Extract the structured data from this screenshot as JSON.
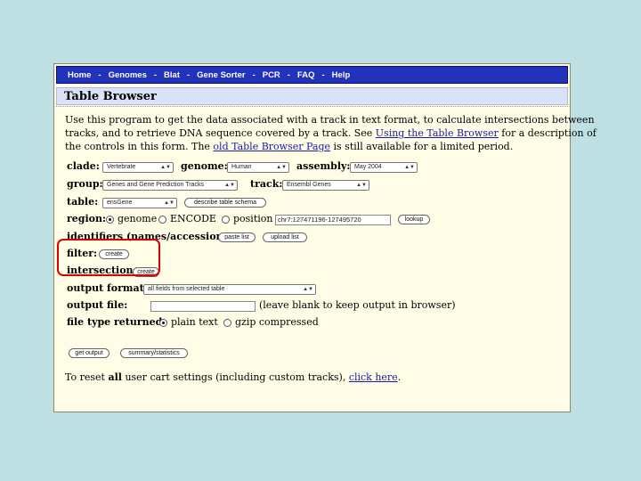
{
  "nav": {
    "items": [
      "Home",
      "Genomes",
      "Blat",
      "Gene Sorter",
      "PCR",
      "FAQ",
      "Help"
    ],
    "separator": "-"
  },
  "title": "Table Browser",
  "intro": {
    "line1": "Use this program to get the data associated with a track in text format, to calculate intersections between",
    "line2_pre": "tracks, and to retrieve DNA sequence covered by a track. See ",
    "line2_link": "Using the Table Browser",
    "line2_post": " for a description of",
    "line3_pre": "the controls in this form. The ",
    "line3_link": "old Table Browser Page",
    "line3_post": " is still available for a limited period."
  },
  "form": {
    "clade_label": "clade:",
    "clade_value": "Vertebrate",
    "genome_label": "genome:",
    "genome_value": "Human",
    "assembly_label": "assembly:",
    "assembly_value": "May 2004",
    "group_label": "group:",
    "group_value": "Genes and Gene Prediction Tracks",
    "track_label": "track:",
    "track_value": "Ensembl Genes",
    "table_label": "table:",
    "table_value": "ensGene",
    "describe_button": "describe table schema",
    "region_label": "region:",
    "region_genome": "genome",
    "region_encode": "ENCODE",
    "region_position": "position",
    "position_value": "chr7:127471196-127495720",
    "lookup_button": "lookup",
    "identifiers_label": "identifiers (names/accessions):",
    "paste_button": "paste list",
    "upload_button": "upload list",
    "filter_label": "filter:",
    "filter_button": "create",
    "intersection_label": "intersection:",
    "intersection_button": "create",
    "output_format_label": "output format:",
    "output_format_value": "all fields from selected table",
    "output_file_label": "output file:",
    "output_file_value": "",
    "output_file_hint": "(leave blank to keep output in browser)",
    "file_type_label": "file type returned:",
    "file_type_plain": "plain text",
    "file_type_gzip": "gzip compressed",
    "get_output_button": "get output",
    "summary_button": "summary/statistics"
  },
  "reset": {
    "pre": "To reset ",
    "bold": "all",
    "mid": " user cart settings (including custom tracks), ",
    "link": "click here",
    "post": "."
  },
  "colors": {
    "nav_bg": "#2233bb",
    "highlight": "#dd0000",
    "page_bg": "#bfe0e3",
    "panel_bg": "#fffde6"
  }
}
